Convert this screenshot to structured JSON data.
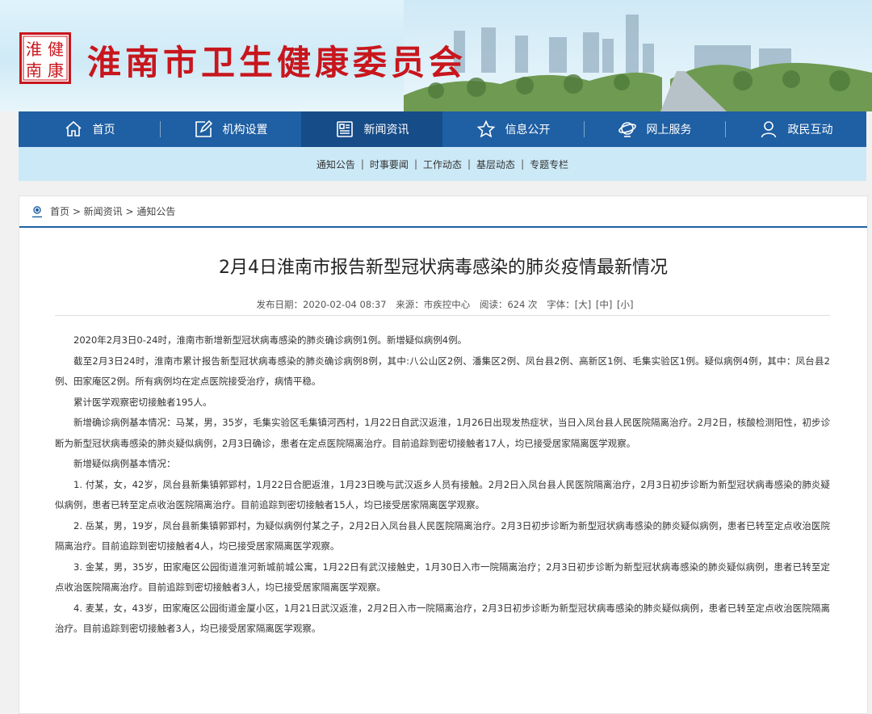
{
  "site": {
    "title": "淮南市卫生健康委员会",
    "seal_text": "淮健南康"
  },
  "nav": [
    {
      "label": "首页",
      "icon": "home-icon"
    },
    {
      "label": "机构设置",
      "icon": "edit-icon"
    },
    {
      "label": "新闻资讯",
      "icon": "news-icon",
      "active": true
    },
    {
      "label": "信息公开",
      "icon": "star-icon"
    },
    {
      "label": "网上服务",
      "icon": "globe-icon"
    },
    {
      "label": "政民互动",
      "icon": "user-icon"
    }
  ],
  "subnav": [
    "通知公告",
    "时事要闻",
    "工作动态",
    "基层动态",
    "专题专栏"
  ],
  "subnav_sep": "|",
  "breadcrumb": {
    "text": "首页 > 新闻资讯 > 通知公告"
  },
  "article": {
    "title": "2月4日淮南市报告新型冠状病毒感染的肺炎疫情最新情况",
    "meta": {
      "date": "发布日期：2020-02-04 08:37",
      "source": "来源：市疾控中心",
      "views": "阅读：624 次",
      "font_label": "字体：",
      "size_large": "[大]",
      "size_medium": "[中]",
      "size_small": "[小]"
    },
    "paragraphs": [
      "2020年2月3日0-24时，淮南市新增新型冠状病毒感染的肺炎确诊病例1例。新增疑似病例4例。",
      "截至2月3日24时，淮南市累计报告新型冠状病毒感染的肺炎确诊病例8例，其中:八公山区2例、潘集区2例、凤台县2例、高新区1例、毛集实验区1例。疑似病例4例，其中：凤台县2例、田家庵区2例。所有病例均在定点医院接受治疗，病情平稳。",
      "累计医学观察密切接触者195人。",
      "新增确诊病例基本情况：马某，男，35岁，毛集实验区毛集镇河西村，1月22日自武汉返淮，1月26日出现发热症状，当日入凤台县人民医院隔离治疗。2月2日，核酸检测阳性，初步诊断为新型冠状病毒感染的肺炎疑似病例，2月3日确诊，患者在定点医院隔离治疗。目前追踪到密切接触者17人，均已接受居家隔离医学观察。",
      "新增疑似病例基本情况：",
      "1. 付某，女，42岁，凤台县新集镇郭郢村，1月22日合肥返淮，1月23日晚与武汉返乡人员有接触。2月2日入凤台县人民医院隔离治疗，2月3日初步诊断为新型冠状病毒感染的肺炎疑似病例，患者已转至定点收治医院隔离治疗。目前追踪到密切接触者15人，均已接受居家隔离医学观察。",
      "2. 岳某，男，19岁，凤台县新集镇郭郢村，为疑似病例付某之子，2月2日入凤台县人民医院隔离治疗。2月3日初步诊断为新型冠状病毒感染的肺炎疑似病例，患者已转至定点收治医院隔离治疗。目前追踪到密切接触者4人，均已接受居家隔离医学观察。",
      "3. 金某，男，35岁，田家庵区公园街道淮河新城前城公寓，1月22日有武汉接触史，1月30日入市一院隔离治疗；2月3日初步诊断为新型冠状病毒感染的肺炎疑似病例，患者已转至定点收治医院隔离治疗。目前追踪到密切接触者3人，均已接受居家隔离医学观察。",
      "4. 麦某，女，43岁，田家庵区公园街道金厦小区，1月21日武汉返淮，2月2日入市一院隔离治疗，2月3日初步诊断为新型冠状病毒感染的肺炎疑似病例，患者已转至定点收治医院隔离治疗。目前追踪到密切接触者3人，均已接受居家隔离医学观察。"
    ]
  },
  "colors": {
    "brand_red": "#c8161d",
    "nav_blue": "#1f5fa3",
    "nav_active": "#164c88",
    "subnav_bg": "#cce9f7"
  }
}
